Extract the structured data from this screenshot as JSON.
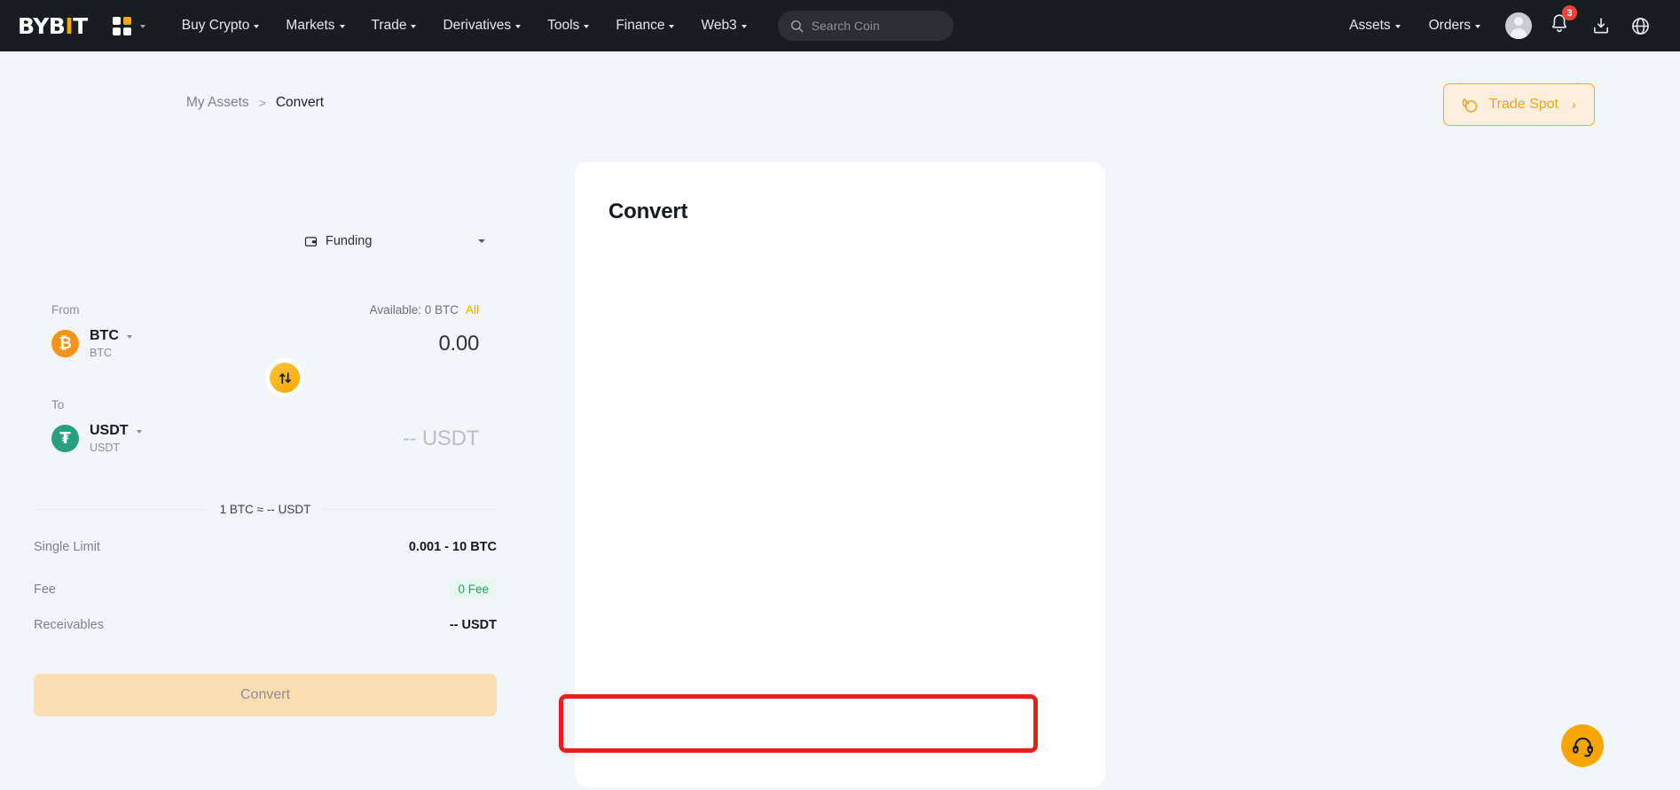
{
  "nav": {
    "logo": {
      "prefix": "BYB",
      "accent": "I",
      "suffix": "T"
    },
    "grid_icon": "apps-grid-icon",
    "items": [
      {
        "label": "Buy Crypto"
      },
      {
        "label": "Markets"
      },
      {
        "label": "Trade"
      },
      {
        "label": "Derivatives"
      },
      {
        "label": "Tools"
      },
      {
        "label": "Finance"
      },
      {
        "label": "Web3"
      }
    ],
    "search": {
      "placeholder": "Search Coin",
      "value": "",
      "icon": "search-icon"
    },
    "right_items": [
      {
        "label": "Assets"
      },
      {
        "label": "Orders"
      }
    ],
    "notification_count": "3",
    "icons": [
      "avatar",
      "bell-icon",
      "download-icon",
      "globe-icon"
    ]
  },
  "breadcrumb": {
    "parent": "My Assets",
    "separator": ">",
    "current": "Convert"
  },
  "trade_spot": {
    "label": "Trade Spot",
    "chevron": "›",
    "icon": "spot-coin-icon"
  },
  "card": {
    "title": "Convert",
    "wallet": {
      "label": "Funding",
      "icon": "wallet-icon"
    },
    "from": {
      "label": "From",
      "available": "Available: 0 BTC",
      "all_label": "All",
      "coin_symbol": "BTC",
      "coin_sub": "BTC",
      "coin_glyph": "₿",
      "amount": "0.00"
    },
    "swap_icon": "swap-vertical-icon",
    "to": {
      "label": "To",
      "coin_symbol": "USDT",
      "coin_sub": "USDT",
      "coin_glyph": "₮",
      "amount": "-- USDT"
    },
    "rate": "1 BTC ≈ -- USDT",
    "details": [
      {
        "key": "Single Limit",
        "value": "0.001 - 10 BTC"
      },
      {
        "key": "Fee",
        "value": "0 Fee"
      },
      {
        "key": "Receivables",
        "value": "-- USDT"
      }
    ],
    "convert_button": "Convert"
  },
  "support": {
    "icon": "headset-icon"
  },
  "colors": {
    "brand_orange": "#f7a600",
    "nav_bg": "#1a1d20",
    "page_bg": "#f4f5f9",
    "btc_orange": "#f7931a",
    "usdt_green": "#26a17b",
    "fee_green": "#1fa363",
    "badge_red": "#f04438",
    "highlight_red": "#e81f1b"
  }
}
